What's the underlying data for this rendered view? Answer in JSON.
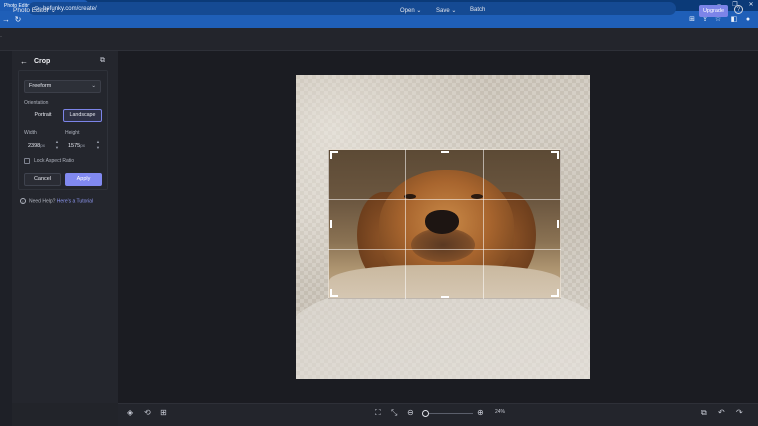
{
  "browser": {
    "tab_title": "Photo Editor | BeFunky: Free On...",
    "tab_close": "✕",
    "new_tab": "+",
    "url": "befunky.com/create/",
    "win_minimize": "–",
    "win_restore": "❐",
    "win_close": "✕"
  },
  "header": {
    "app_menu": "Photo Editor ⌄",
    "open_label": "Open ⌄",
    "save_label": "Save ⌄",
    "batch_label": "Batch",
    "upgrade_label": "Upgrade",
    "help_label": "?"
  },
  "panel": {
    "title": "Crop",
    "back_icon": "←",
    "copy_icon": "⧉",
    "ratio_select": "Freeform",
    "ratio_chevron": "⌄",
    "orientation_label": "Orientation",
    "portrait_label": "Portrait",
    "landscape_label": "Landscape",
    "width_label": "Width",
    "height_label": "Height",
    "width_value": "2398",
    "height_value": "1575",
    "unit": "px",
    "lock_aspect_label": "Lock Aspect Ratio",
    "cancel_label": "Cancel",
    "apply_label": "Apply",
    "need_help_label": "Need Help?",
    "tutorial_link": "Here's a Tutorial"
  },
  "bottom": {
    "zoom_value": "24%",
    "zoom_level": 0.24
  },
  "colors": {
    "accent": "#7c84e8",
    "background": "#1b1c22",
    "panel": "#24262d",
    "browser_chrome": "#1f5fb8"
  }
}
